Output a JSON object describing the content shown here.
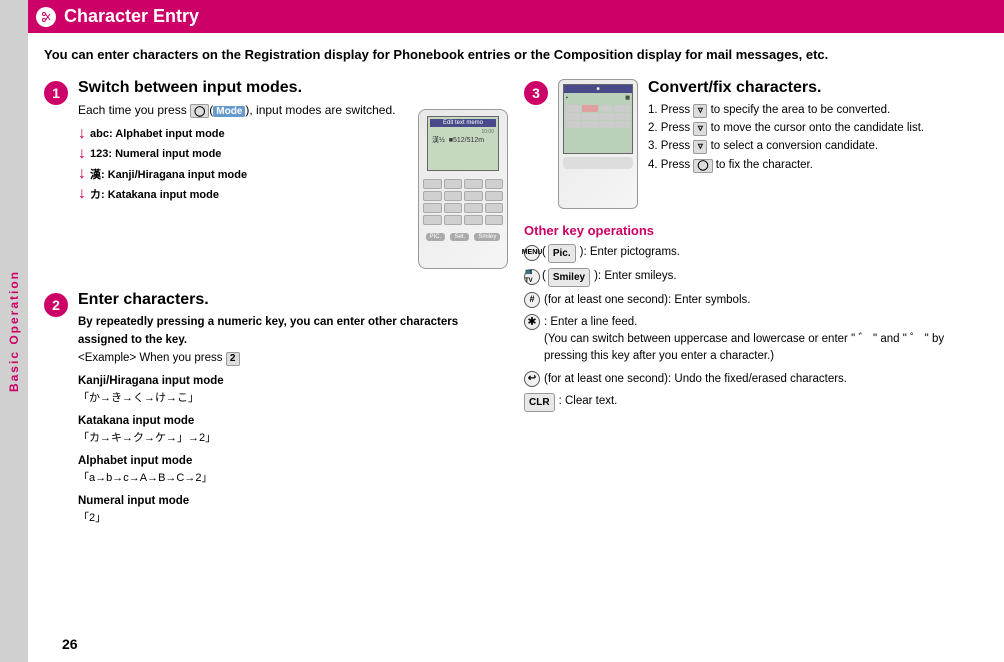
{
  "page": {
    "number": "26",
    "sidebar_label": "Basic Operation"
  },
  "header": {
    "title": "Character Entry",
    "icon_label": "scissors-icon"
  },
  "intro": {
    "text": "You can enter characters on the Registration display for Phonebook entries or the Composition display for mail messages, etc."
  },
  "step1": {
    "number": "1",
    "title": "Switch between input modes.",
    "body": "Each time you press",
    "key": "Mode",
    "body2": ", input modes are switched.",
    "modes": [
      {
        "arrow": "↓",
        "label": "abc: Alphabet input mode"
      },
      {
        "arrow": "↓",
        "label": "123: Numeral input mode"
      },
      {
        "arrow": "↓",
        "label": "漢: Kanji/Hiragana input mode"
      },
      {
        "arrow": "↓",
        "label": "カ: Katakana input mode"
      }
    ]
  },
  "step2": {
    "number": "2",
    "title": "Enter characters.",
    "subtitle": "By repeatedly pressing a numeric key, you can enter other characters assigned to the key.",
    "example_prefix": "<Example> When you press",
    "example_key": "2",
    "kanji_head": "Kanji/Hiragana input mode",
    "kanji_chars": "「か→き→く→け→こ」",
    "katakana_head": "Katakana input mode",
    "katakana_chars": "「カ→キ→ク→ケ→」→2」",
    "alphabet_head": "Alphabet input mode",
    "alphabet_chars": "「a→b→c→A→B→C→2」",
    "numeral_head": "Numeral input mode",
    "numeral_chars": "「2」"
  },
  "step3": {
    "number": "3",
    "title": "Convert/fix characters.",
    "steps": [
      "1. Press  to specify the area to be converted.",
      "2. Press  to move the cursor onto the candidate list.",
      "3. Press  to select a conversion candidate.",
      "4. Press  to fix the character."
    ]
  },
  "other_ops": {
    "title": "Other key operations",
    "items": [
      {
        "key_type": "menu_pic",
        "key_icon": "MENU",
        "key_label": "Pic.",
        "description": "): Enter pictograms."
      },
      {
        "key_type": "tv_smiley",
        "key_icon": "TV",
        "key_label": "Smiley",
        "description": "): Enter smileys."
      },
      {
        "key_type": "hash",
        "description": "(for at least one second): Enter symbols."
      },
      {
        "key_type": "star",
        "description": ": Enter a line feed.\n(You can switch between uppercase and lowercase or enter \" ゛ \" and \" ゜ \" by pressing this key after you enter a character.)"
      },
      {
        "key_type": "arrow_circle",
        "description": "(for at least one second): Undo the fixed/erased characters."
      },
      {
        "key_type": "clr",
        "description": ": Clear text."
      }
    ]
  }
}
